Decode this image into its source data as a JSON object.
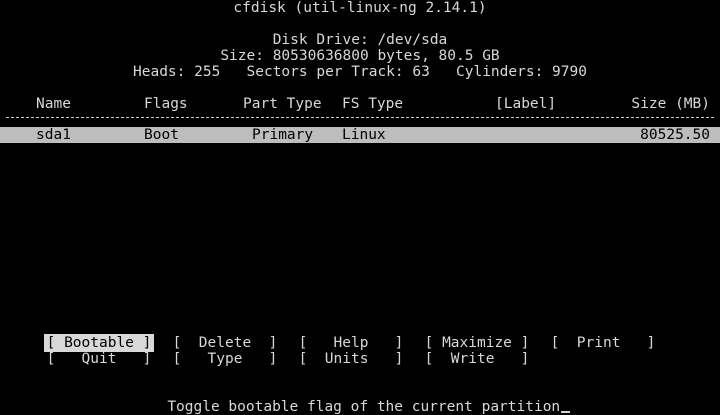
{
  "header": {
    "title": "cfdisk (util-linux-ng 2.14.1)",
    "disk_drive": "Disk Drive: /dev/sda",
    "size": "Size: 80530636800 bytes, 80.5 GB",
    "geometry": "Heads: 255   Sectors per Track: 63   Cylinders: 9790"
  },
  "table": {
    "columns": {
      "name": "Name",
      "flags": "Flags",
      "part_type": "Part Type",
      "fs_type": "FS Type",
      "label": "[Label]",
      "size": "Size (MB)"
    },
    "rows": [
      {
        "name": "sda1",
        "flags": "Boot",
        "part_type": "Primary",
        "fs_type": "Linux",
        "label": "",
        "size": "80525.50"
      }
    ]
  },
  "menu": {
    "bootable": "[ Bootable ]",
    "delete": "[  Delete  ]",
    "help": "[   Help   ]",
    "maximize": "[ Maximize ]",
    "print": "[  Print   ]",
    "quit": "[   Quit   ]",
    "type": "[   Type   ]",
    "units": "[  Units   ]",
    "write": "[  Write   ]"
  },
  "status": {
    "message": "Toggle bootable flag of the current partition"
  }
}
